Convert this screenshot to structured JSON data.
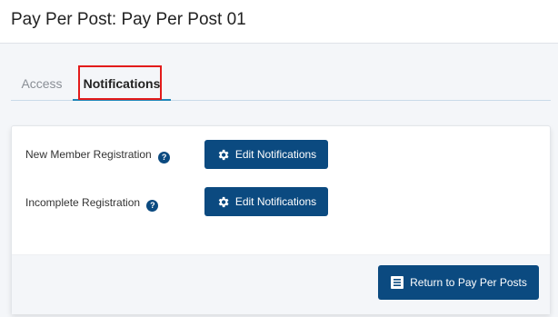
{
  "header": {
    "title": "Pay Per Post: Pay Per Post 01"
  },
  "tabs": [
    {
      "label": "Access"
    },
    {
      "label": "Notifications"
    }
  ],
  "rows": [
    {
      "label": "New Member Registration",
      "button": "Edit Notifications",
      "help_glyph": "?"
    },
    {
      "label": "Incomplete Registration",
      "button": "Edit Notifications",
      "help_glyph": "?"
    }
  ],
  "footer": {
    "return_label": "Return to Pay Per Posts"
  },
  "colors": {
    "primary_button": "#0b4a80",
    "active_tab_underline": "#1f86b8",
    "highlight_box": "#e31b1b"
  },
  "icons": [
    "help-icon",
    "gear-icon",
    "list-icon"
  ]
}
